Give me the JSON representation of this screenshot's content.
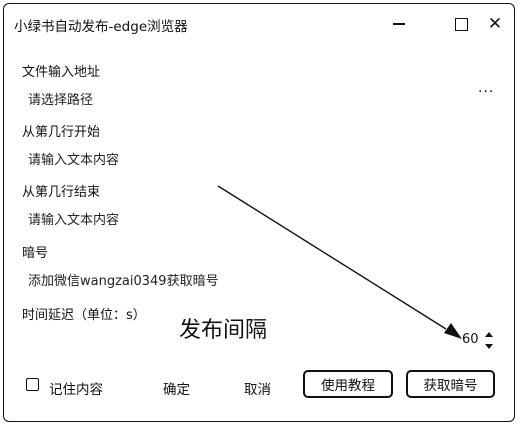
{
  "window": {
    "title": "小绿书自动发布-edge浏览器"
  },
  "form": {
    "file_label": "文件输入地址",
    "file_placeholder": "请选择路径",
    "more": "···",
    "start_label": "从第几行开始",
    "start_placeholder": "请输入文本内容",
    "end_label": "从第几行结束",
    "end_placeholder": "请输入文本内容",
    "code_label": "暗号",
    "code_placeholder": "添加微信wangzai0349获取暗号",
    "delay_label": "时间延迟（单位：s）",
    "delay_value": "60"
  },
  "annotation": {
    "text": "发布间隔"
  },
  "footer": {
    "remember_label": "记住内容",
    "ok_label": "确定",
    "cancel_label": "取消",
    "tutorial_label": "使用教程",
    "get_code_label": "获取暗号"
  },
  "icons": [
    "minimize-icon",
    "maximize-icon",
    "close-icon",
    "more-icon",
    "spin-up-icon",
    "spin-down-icon",
    "arrow-annotation"
  ]
}
